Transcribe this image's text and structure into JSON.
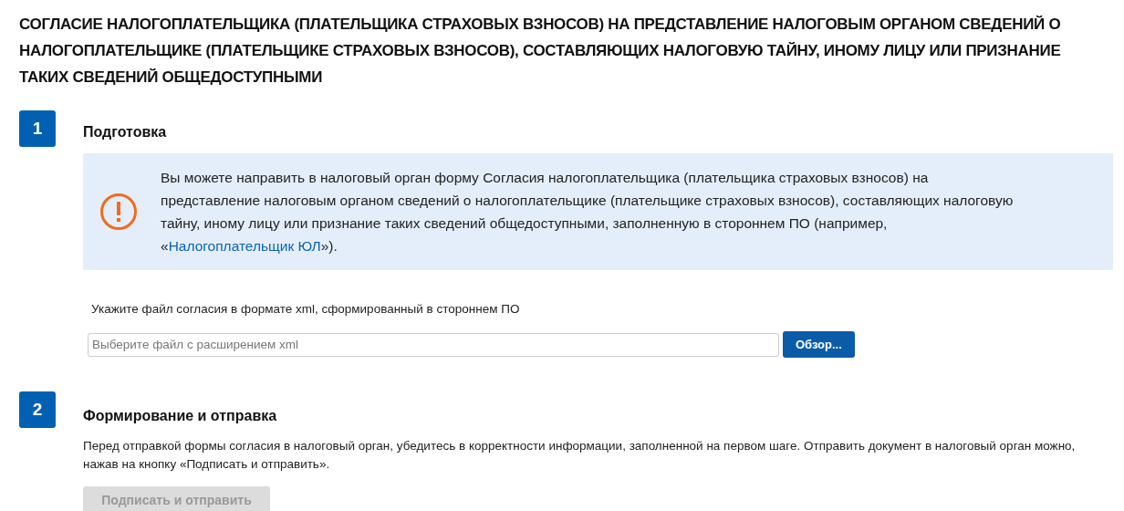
{
  "title": "СОГЛАСИЕ НАЛОГОПЛАТЕЛЬЩИКА (ПЛАТЕЛЬЩИКА СТРАХОВЫХ ВЗНОСОВ) НА ПРЕДСТАВЛЕНИЕ НАЛОГОВЫМ ОРГАНОМ СВЕДЕНИЙ О НАЛОГОПЛАТЕЛЬЩИКЕ (ПЛАТЕЛЬЩИКЕ СТРАХОВЫХ ВЗНОСОВ), СОСТАВЛЯЮЩИХ НАЛОГОВУЮ ТАЙНУ, ИНОМУ ЛИЦУ ИЛИ ПРИЗНАНИЕ ТАКИХ СВЕДЕНИЙ ОБЩЕДОСТУПНЫМИ",
  "step_1": {
    "number": "1",
    "heading": "Подготовка",
    "notice": {
      "text_before": "Вы можете направить в налоговый орган форму Согласия налогоплательщика (плательщика страховых взносов) на представление налоговым органом сведений о налогоплательщике (плательщике страховых взносов), составляющих налоговую тайну, иному лицу или признание таких сведений общедоступными, заполненную в стороннем ПО (например, «",
      "link": "Налогоплательщик ЮЛ",
      "text_after": "»)."
    },
    "file_label": "Укажите файл согласия в формате xml, сформированный в стороннем ПО",
    "file_field": {
      "placeholder": "Выберите файл с расширением xml"
    },
    "browse_button": {
      "label": "Обзор...",
      "disabled": false
    }
  },
  "step_2": {
    "number": "2",
    "heading": "Формирование и отправка",
    "description": "Перед отправкой формы согласия в налоговый орган, убедитесь в корректности информации, заполненной на первом шаге. Отправить документ в налоговый орган можно, нажав на кнопку «Подписать и отправить».",
    "submit_button": {
      "label": "Подписать и отправить",
      "disabled": true
    }
  }
}
